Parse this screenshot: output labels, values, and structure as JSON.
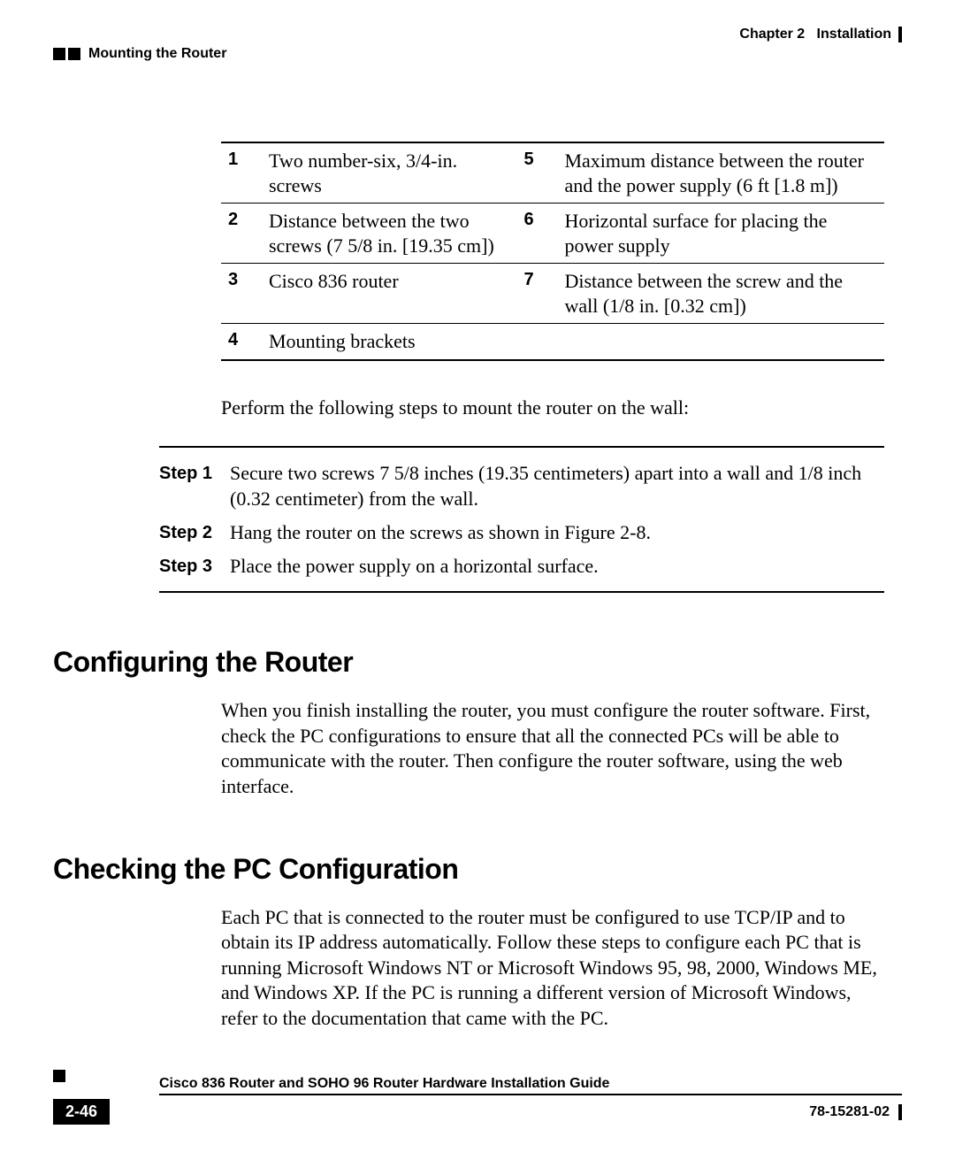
{
  "header": {
    "chapter_label": "Chapter 2",
    "chapter_title": "Installation",
    "section_title": "Mounting the Router"
  },
  "table": {
    "rows": [
      {
        "n1": "1",
        "t1": "Two number-six, 3/4-in. screws",
        "n2": "5",
        "t2": "Maximum distance between the router and the power supply (6 ft [1.8 m])"
      },
      {
        "n1": "2",
        "t1": "Distance between the two screws (7 5/8 in. [19.35 cm])",
        "n2": "6",
        "t2": "Horizontal surface for placing the power supply"
      },
      {
        "n1": "3",
        "t1": "Cisco 836 router",
        "n2": "7",
        "t2": "Distance between the screw and the wall (1/8 in. [0.32 cm])"
      },
      {
        "n1": "4",
        "t1": "Mounting brackets",
        "n2": "",
        "t2": ""
      }
    ]
  },
  "intro": "Perform the following steps to mount the router on the wall:",
  "steps": [
    {
      "label": "Step 1",
      "text": "Secure two screws 7 5/8 inches (19.35 centimeters) apart into a wall and 1/8 inch (0.32 centimeter) from the wall."
    },
    {
      "label": "Step 2",
      "text": "Hang the router on the screws as shown in Figure 2-8."
    },
    {
      "label": "Step 3",
      "text": "Place the power supply on a horizontal surface."
    }
  ],
  "sections": {
    "configuring": {
      "heading": "Configuring the Router",
      "body": "When you finish installing the router, you must configure the router software. First, check the PC configurations to ensure that all the connected PCs will be able to communicate with the router. Then configure the router software, using the web interface."
    },
    "checking": {
      "heading": "Checking the PC Configuration",
      "body": "Each PC that is connected to the router must be configured to use TCP/IP and to obtain its IP address automatically. Follow these steps to configure each PC that is running Microsoft Windows NT or Microsoft Windows 95, 98, 2000, Windows ME, and Windows XP. If the PC is running a different version of Microsoft Windows, refer to the documentation that came with the PC."
    }
  },
  "footer": {
    "guide_title": "Cisco 836 Router and SOHO 96 Router Hardware Installation Guide",
    "page_number": "2-46",
    "doc_number": "78-15281-02"
  }
}
